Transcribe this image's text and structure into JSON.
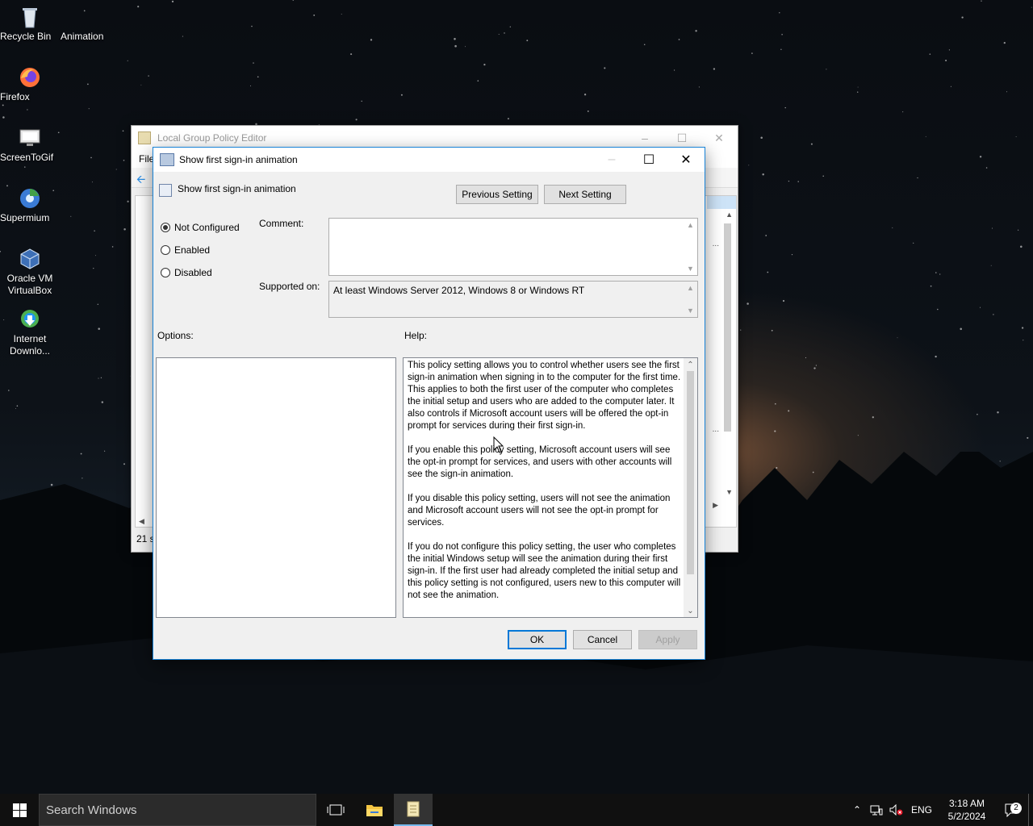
{
  "desktop": {
    "icons": [
      {
        "label": "Recycle Bin",
        "icon": "recycle-bin-icon"
      },
      {
        "label": "Animation",
        "icon": "animation-icon"
      },
      {
        "label": "Firefox",
        "icon": "firefox-icon"
      },
      {
        "label": "ScreenToGif",
        "icon": "screentogif-icon"
      },
      {
        "label": "Supermium",
        "icon": "supermium-icon"
      },
      {
        "label": "Oracle VM VirtualBox",
        "icon": "virtualbox-icon"
      },
      {
        "label": "Internet Downlo...",
        "icon": "internet-download-manager-icon"
      }
    ]
  },
  "bg_window": {
    "title": "Local Group Policy Editor",
    "menu_first": "File",
    "status_partial": "21 s",
    "ellipsis_1": "...",
    "ellipsis_2": "..."
  },
  "dialog": {
    "title": "Show first sign-in animation",
    "setting_name": "Show first sign-in animation",
    "prev_button": "Previous Setting",
    "next_button": "Next Setting",
    "radios": [
      {
        "label": "Not Configured",
        "checked": true
      },
      {
        "label": "Enabled",
        "checked": false
      },
      {
        "label": "Disabled",
        "checked": false
      }
    ],
    "comment_label": "Comment:",
    "comment_value": "",
    "supported_label": "Supported on:",
    "supported_value": "At least Windows Server 2012, Windows 8 or Windows RT",
    "options_label": "Options:",
    "help_label": "Help:",
    "help_paragraphs": [
      "This policy setting allows you to control whether users see the first sign-in animation when signing in to the computer for the first time.  This applies to both the first user of the computer who completes the initial setup and users who are added to the computer later.  It also controls if Microsoft account users will be offered the opt-in prompt for services during their first sign-in.",
      "If you enable this policy setting, Microsoft account users will see the opt-in prompt for services, and users with other accounts will see the sign-in animation.",
      "If you disable this policy setting, users will not see the animation and Microsoft account users will not see the opt-in prompt for services.",
      "If you do not configure this policy setting, the user who completes the initial Windows setup will see the animation during their first sign-in. If the first user had already completed the initial setup and this policy setting is not configured, users new to this computer will not see the animation."
    ],
    "ok_button": "OK",
    "cancel_button": "Cancel",
    "apply_button": "Apply"
  },
  "taskbar": {
    "search_placeholder": "Search Windows",
    "language": "ENG",
    "time": "3:18 AM",
    "date": "5/2/2024",
    "notification_count": "2"
  },
  "colors": {
    "accent": "#0078d7",
    "dialog_border": "#1883d7",
    "taskbar": "#101010"
  }
}
